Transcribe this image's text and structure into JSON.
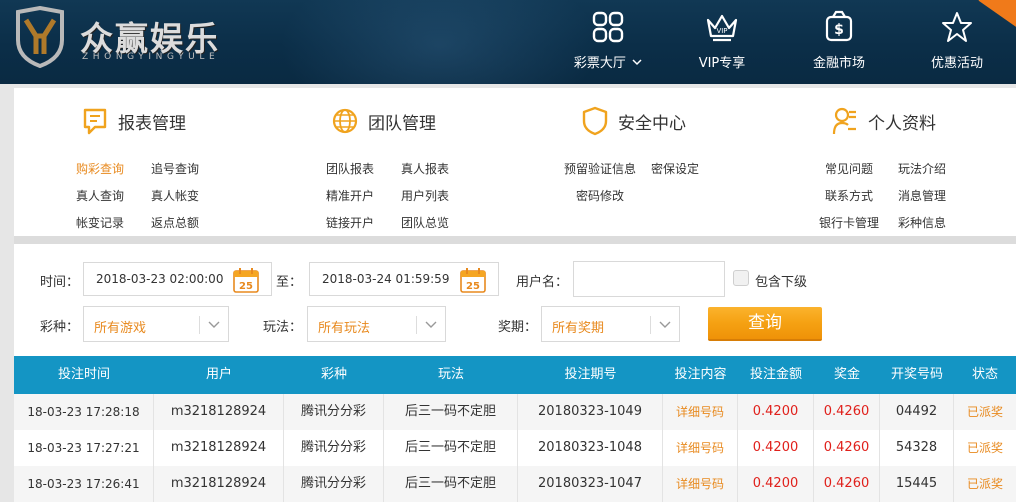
{
  "header": {
    "brand_cn": "众赢娱乐",
    "brand_en": "ZHONGYINGYULE",
    "nav": [
      {
        "label": "彩票大厅",
        "icon": "grid-icon"
      },
      {
        "label": "VIP专享",
        "icon": "crown-icon"
      },
      {
        "label": "金融市场",
        "icon": "money-bag-icon"
      },
      {
        "label": "优惠活动",
        "icon": "star-icon"
      }
    ]
  },
  "menu": {
    "groups": [
      {
        "title": "报表管理",
        "links": [
          "购彩查询",
          "追号查询",
          "真人查询",
          "真人帐变",
          "帐变记录",
          "返点总额"
        ]
      },
      {
        "title": "团队管理",
        "links": [
          "团队报表",
          "真人报表",
          "精准开户",
          "用户列表",
          "链接开户",
          "团队总览"
        ]
      },
      {
        "title": "安全中心",
        "links": [
          "预留验证信息",
          "密保设定",
          "密码修改"
        ]
      },
      {
        "title": "个人资料",
        "links": [
          "常见问题",
          "玩法介绍",
          "联系方式",
          "消息管理",
          "银行卡管理",
          "彩种信息"
        ]
      }
    ],
    "active_link": "购彩查询"
  },
  "filters": {
    "time_label": "时间：",
    "start_time": "2018-03-23 02:00:00",
    "to_label": "至：",
    "end_time": "2018-03-24 01:59:59",
    "calendar_day": "25",
    "username_label": "用户名：",
    "username_value": "",
    "include_sub_label": "包含下级",
    "lottery_label": "彩种：",
    "lottery_value": "所有游戏",
    "play_label": "玩法：",
    "play_value": "所有玩法",
    "period_label": "奖期：",
    "period_value": "所有奖期",
    "search_label": "查询"
  },
  "table": {
    "headers": [
      "投注时间",
      "用户",
      "彩种",
      "玩法",
      "投注期号",
      "投注内容",
      "投注金额",
      "奖金",
      "开奖号码",
      "状态"
    ],
    "rows": [
      [
        "18-03-23 17:28:18",
        "m3218128924",
        "腾讯分分彩",
        "后三一码不定胆",
        "20180323-1049",
        "详细号码",
        "0.4200",
        "0.4260",
        "04492",
        "已派奖"
      ],
      [
        "18-03-23 17:27:21",
        "m3218128924",
        "腾讯分分彩",
        "后三一码不定胆",
        "20180323-1048",
        "详细号码",
        "0.4200",
        "0.4260",
        "54328",
        "已派奖"
      ],
      [
        "18-03-23 17:26:41",
        "m3218128924",
        "腾讯分分彩",
        "后三一码不定胆",
        "20180323-1047",
        "详细号码",
        "0.4200",
        "0.4260",
        "15445",
        "已派奖"
      ]
    ]
  },
  "colors": {
    "header_bg": "#0b2e48",
    "accent_orange": "#e88a1f",
    "table_header": "#1495c4",
    "money_red": "#e0201b",
    "icon_gold": "#f0a31e"
  }
}
